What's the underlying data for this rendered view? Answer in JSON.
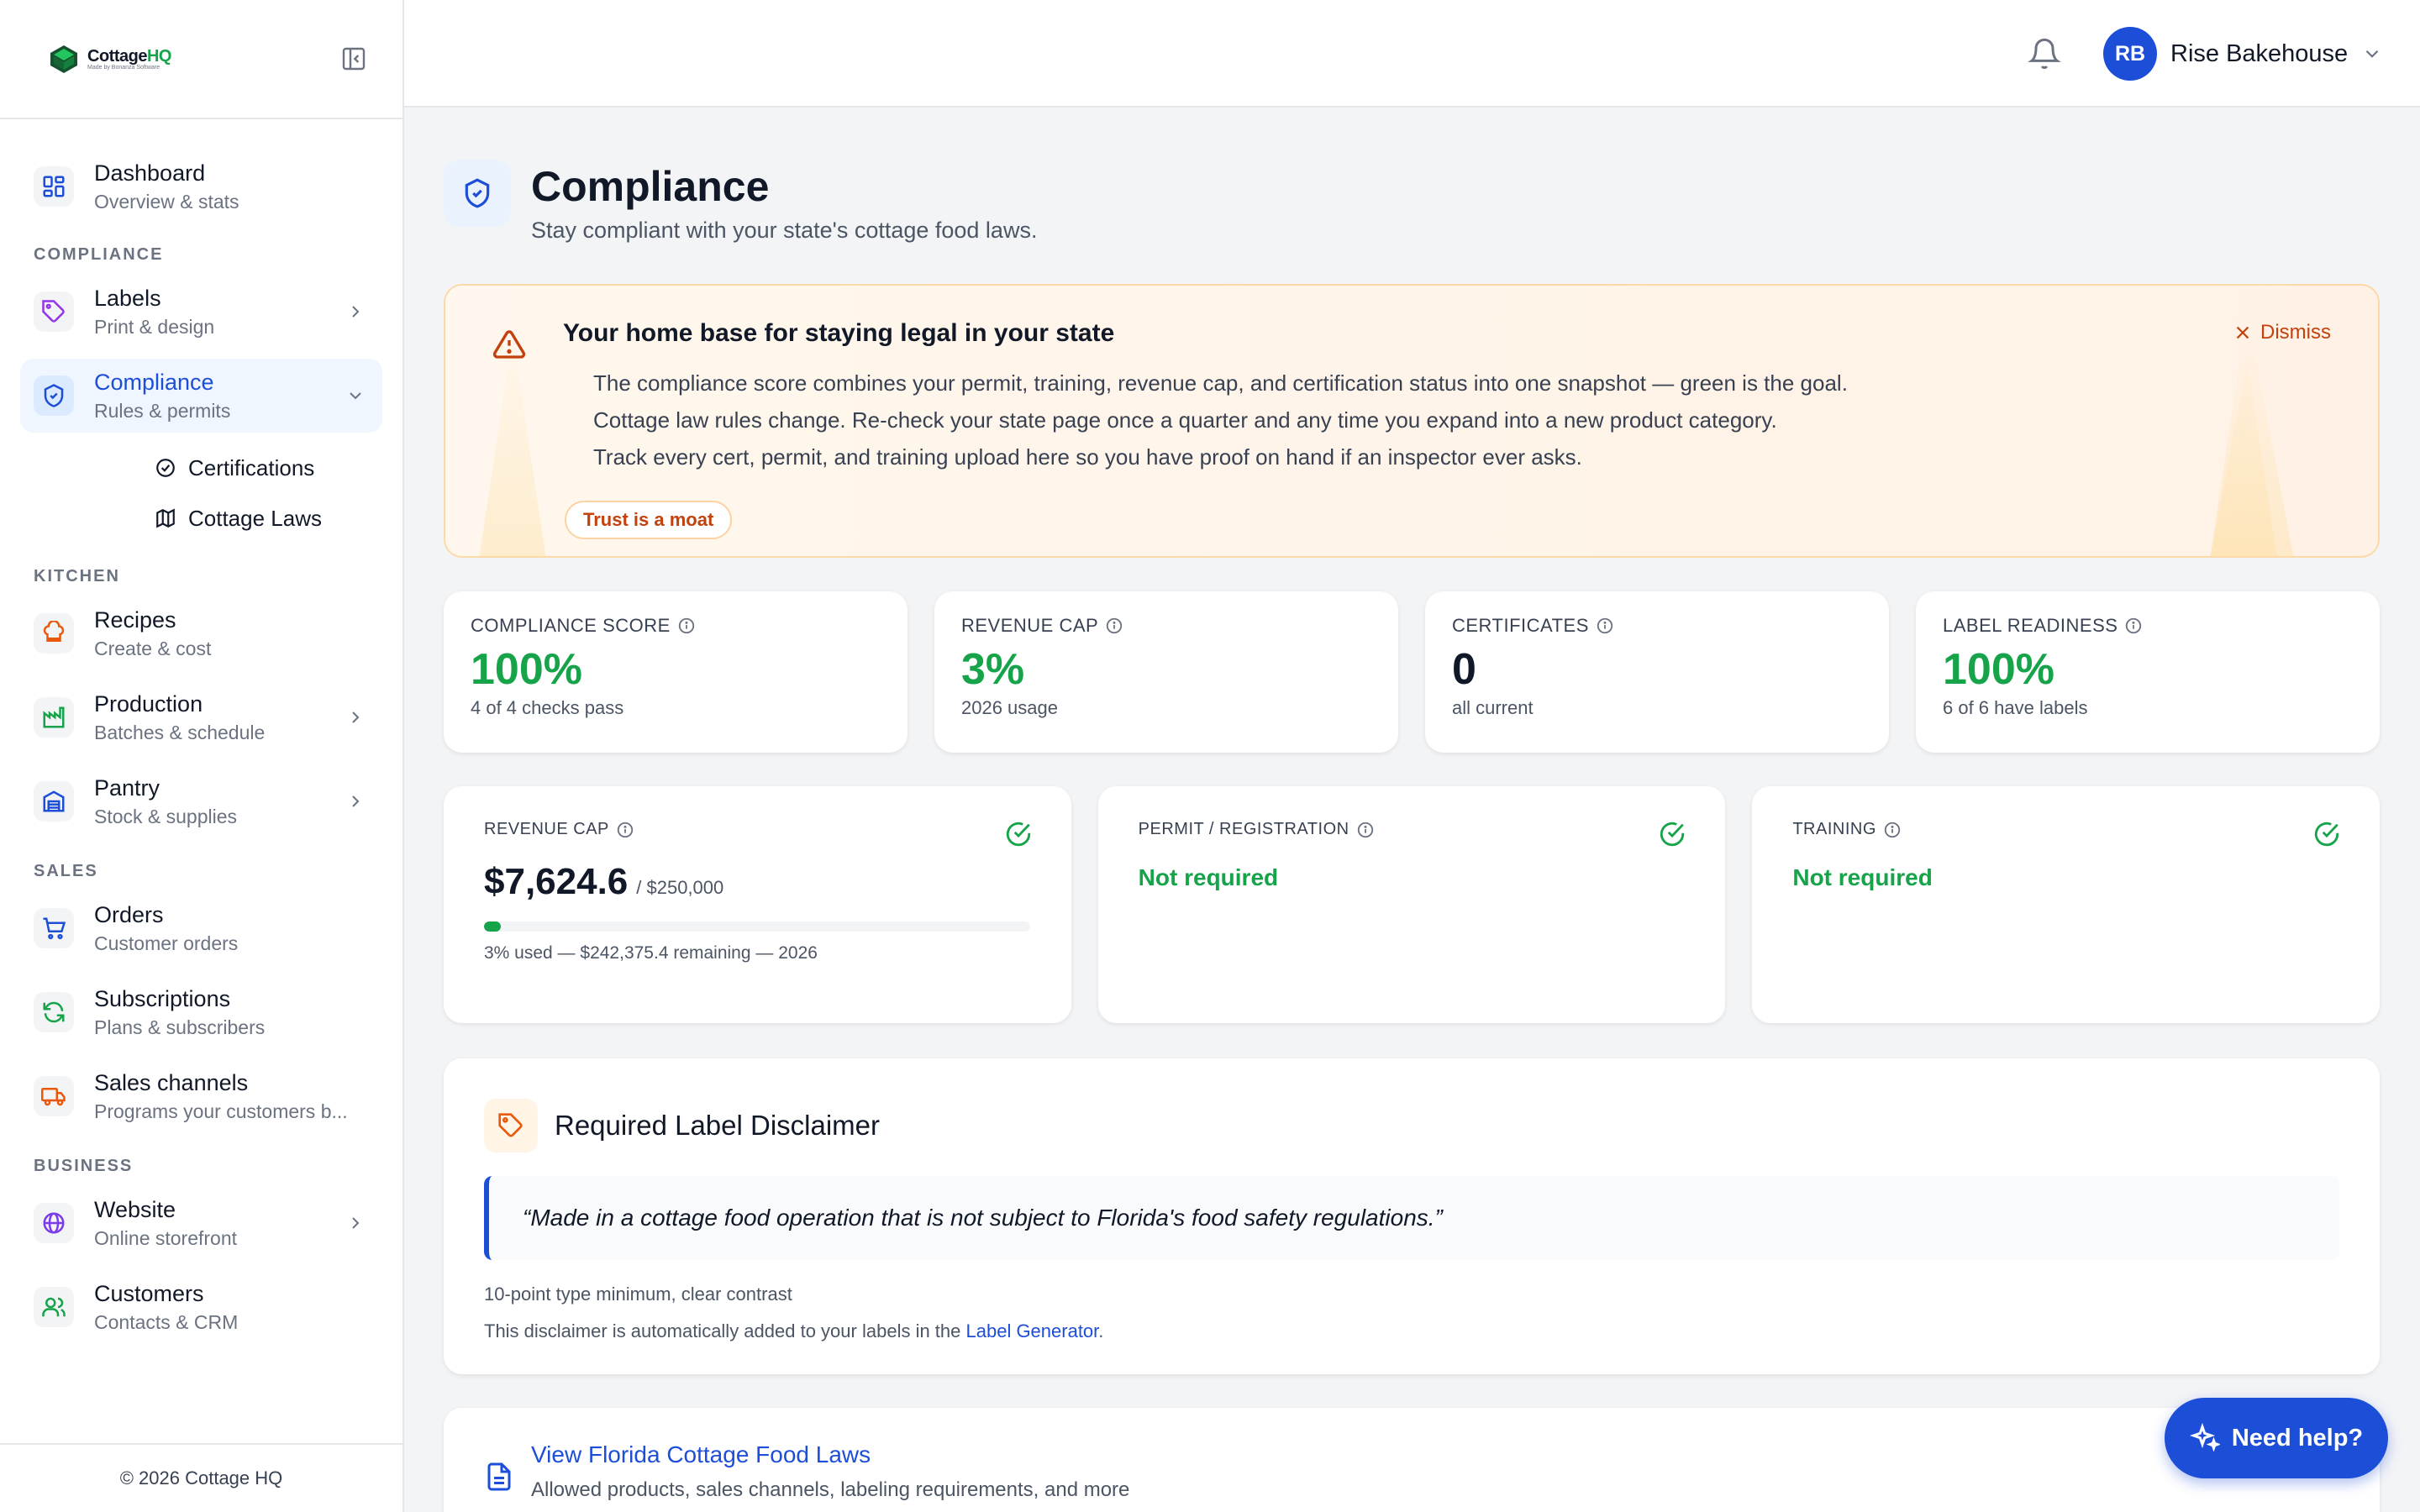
{
  "brand": {
    "name_main": "Cottage",
    "name_accent": "HQ",
    "tagline": "Made by Bonanza Software"
  },
  "header": {
    "avatar_initials": "RB",
    "user_name": "Rise Bakehouse"
  },
  "sidebar": {
    "dashboard": {
      "label": "Dashboard",
      "sub": "Overview & stats"
    },
    "sections": {
      "compliance": "COMPLIANCE",
      "kitchen": "KITCHEN",
      "sales": "SALES",
      "business": "BUSINESS"
    },
    "labels": {
      "label": "Labels",
      "sub": "Print & design"
    },
    "compliance": {
      "label": "Compliance",
      "sub": "Rules & permits"
    },
    "compliance_children": {
      "certifications": "Certifications",
      "cottage_laws": "Cottage Laws"
    },
    "recipes": {
      "label": "Recipes",
      "sub": "Create & cost"
    },
    "production": {
      "label": "Production",
      "sub": "Batches & schedule"
    },
    "pantry": {
      "label": "Pantry",
      "sub": "Stock & supplies"
    },
    "orders": {
      "label": "Orders",
      "sub": "Customer orders"
    },
    "subscriptions": {
      "label": "Subscriptions",
      "sub": "Plans & subscribers"
    },
    "sales_channels": {
      "label": "Sales channels",
      "sub": "Programs your customers b..."
    },
    "website": {
      "label": "Website",
      "sub": "Online storefront"
    },
    "customers": {
      "label": "Customers",
      "sub": "Contacts & CRM"
    },
    "footer": "© 2026 Cottage HQ"
  },
  "page": {
    "title": "Compliance",
    "subtitle": "Stay compliant with your state's cottage food laws."
  },
  "banner": {
    "title": "Your home base for staying legal in your state",
    "lines": [
      "The compliance score combines your permit, training, revenue cap, and certification status into one snapshot — green is the goal.",
      "Cottage law rules change. Re-check your state page once a quarter and any time you expand into a new product category.",
      "Track every cert, permit, and training upload here so you have proof on hand if an inspector ever asks."
    ],
    "tag": "Trust is a moat",
    "dismiss": "Dismiss"
  },
  "stats": {
    "score": {
      "label": "COMPLIANCE SCORE",
      "value": "100%",
      "sub": "4 of 4 checks pass"
    },
    "revenue": {
      "label": "REVENUE CAP",
      "value": "3%",
      "sub": "2026 usage"
    },
    "certs": {
      "label": "CERTIFICATES",
      "value": "0",
      "sub": "all current"
    },
    "labels": {
      "label": "LABEL READINESS",
      "value": "100%",
      "sub": "6 of 6 have labels"
    }
  },
  "checks": {
    "revenue": {
      "label": "REVENUE CAP",
      "amount": "$7,624.6",
      "limit": "/ $250,000",
      "used_percent": 3,
      "note": "3% used — $242,375.4 remaining — 2026"
    },
    "permit": {
      "label": "PERMIT / REGISTRATION",
      "status": "Not required"
    },
    "training": {
      "label": "TRAINING",
      "status": "Not required"
    }
  },
  "disclaimer": {
    "title": "Required Label Disclaimer",
    "quote": "“Made in a cottage food operation that is not subject to Florida's food safety regulations.”",
    "note1": "10-point type minimum, clear contrast",
    "note2_prefix": "This disclaimer is automatically added to your labels in the ",
    "note2_link": "Label Generator",
    "note2_suffix": "."
  },
  "laws": {
    "title": "View Florida Cottage Food Laws",
    "sub": "Allowed products, sales channels, labeling requirements, and more"
  },
  "help": {
    "label": "Need help?"
  },
  "colors": {
    "accent": "#1d4ed8",
    "success": "#16a34a",
    "warning": "#c2410c"
  }
}
